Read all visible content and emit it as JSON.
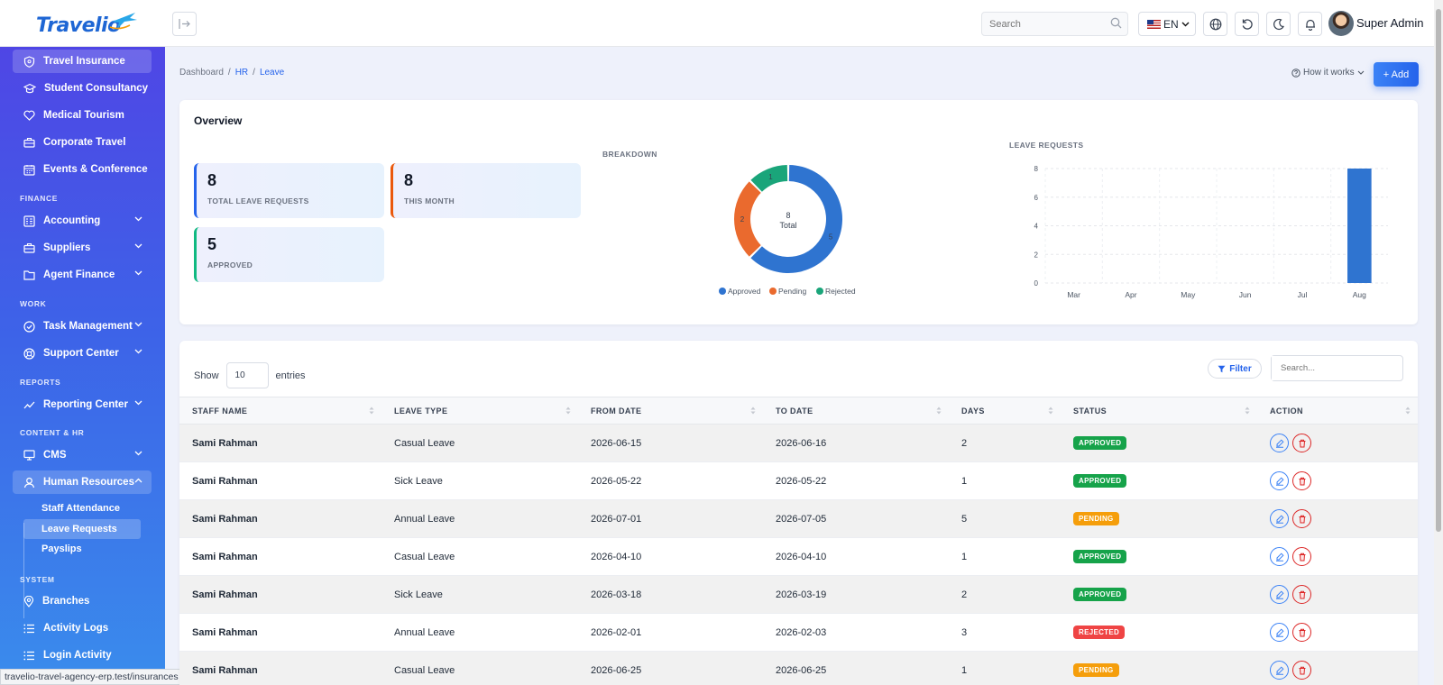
{
  "brand": {
    "name": "Travelio"
  },
  "header": {
    "search_placeholder": "Search",
    "language": "EN",
    "user_name": "Super Admin"
  },
  "sidebar": {
    "top_items": [
      {
        "label": "Travel Insurance",
        "icon": "shield-icon"
      },
      {
        "label": "Student Consultancy",
        "icon": "graduation-cap-icon"
      },
      {
        "label": "Medical Tourism",
        "icon": "heart-icon"
      },
      {
        "label": "Corporate Travel",
        "icon": "briefcase-icon"
      },
      {
        "label": "Events & Conference",
        "icon": "calendar-icon"
      }
    ],
    "sections": {
      "finance": "FINANCE",
      "work": "WORK",
      "reports": "REPORTS",
      "content_hr": "CONTENT & HR",
      "system": "SYSTEM"
    },
    "finance_items": [
      {
        "label": "Accounting"
      },
      {
        "label": "Suppliers"
      },
      {
        "label": "Agent Finance"
      }
    ],
    "work_items": [
      {
        "label": "Task Management"
      },
      {
        "label": "Support Center"
      }
    ],
    "reports_items": [
      {
        "label": "Reporting Center"
      }
    ],
    "content_items": [
      {
        "label": "CMS"
      },
      {
        "label": "Human Resources"
      }
    ],
    "hr_sub": [
      {
        "label": "Staff Attendance"
      },
      {
        "label": "Leave Requests"
      },
      {
        "label": "Payslips"
      }
    ],
    "system_items": [
      {
        "label": "Branches"
      },
      {
        "label": "Activity Logs"
      },
      {
        "label": "Login Activity"
      }
    ]
  },
  "status_url": "travelio-travel-agency-erp.test/insurances",
  "breadcrumb": [
    "Dashboard",
    "HR",
    "Leave"
  ],
  "actions": {
    "how_it_works": "How it works",
    "add": "+ Add"
  },
  "overview": {
    "title": "Overview",
    "stats": [
      {
        "value": "8",
        "label": "TOTAL LEAVE REQUESTS",
        "accent": "#2563eb"
      },
      {
        "value": "8",
        "label": "THIS MONTH",
        "accent": "#ea580c"
      },
      {
        "value": "5",
        "label": "APPROVED",
        "accent": "#10b981"
      }
    ],
    "breakdown_title": "BREAKDOWN",
    "leave_requests_title": "LEAVE REQUESTS"
  },
  "chart_data": [
    {
      "type": "pie",
      "variant": "donut",
      "title": "BREAKDOWN",
      "center_value": "8",
      "center_label": "Total",
      "categories": [
        "Approved",
        "Pending",
        "Rejected"
      ],
      "values": [
        5,
        2,
        1
      ],
      "colors": [
        "#2f74d0",
        "#ea6a2e",
        "#1aa57a"
      ],
      "legend": "bottom"
    },
    {
      "type": "bar",
      "title": "LEAVE REQUESTS",
      "categories": [
        "Mar",
        "Apr",
        "May",
        "Jun",
        "Jul",
        "Aug"
      ],
      "values": [
        0,
        0,
        0,
        0,
        0,
        8
      ],
      "ylim": [
        0,
        8
      ],
      "yticks": [
        "0",
        "2",
        "4",
        "6",
        "8"
      ],
      "grid": true,
      "color": "#2f74d0"
    }
  ],
  "table": {
    "show_label": "Show",
    "entries_value": "10",
    "entries_label": "entries",
    "filter_label": "Filter",
    "search_placeholder": "Search...",
    "headers": [
      "STAFF NAME",
      "LEAVE TYPE",
      "FROM DATE",
      "TO DATE",
      "DAYS",
      "STATUS",
      "ACTION"
    ],
    "rows": [
      {
        "name": "Sami Rahman",
        "type": "Casual Leave",
        "from": "2026-06-15",
        "to": "2026-06-16",
        "days": "2",
        "status": "APPROVED"
      },
      {
        "name": "Sami Rahman",
        "type": "Sick Leave",
        "from": "2026-05-22",
        "to": "2026-05-22",
        "days": "1",
        "status": "APPROVED"
      },
      {
        "name": "Sami Rahman",
        "type": "Annual Leave",
        "from": "2026-07-01",
        "to": "2026-07-05",
        "days": "5",
        "status": "PENDING"
      },
      {
        "name": "Sami Rahman",
        "type": "Casual Leave",
        "from": "2026-04-10",
        "to": "2026-04-10",
        "days": "1",
        "status": "APPROVED"
      },
      {
        "name": "Sami Rahman",
        "type": "Sick Leave",
        "from": "2026-03-18",
        "to": "2026-03-19",
        "days": "2",
        "status": "APPROVED"
      },
      {
        "name": "Sami Rahman",
        "type": "Annual Leave",
        "from": "2026-02-01",
        "to": "2026-02-03",
        "days": "3",
        "status": "REJECTED"
      },
      {
        "name": "Sami Rahman",
        "type": "Casual Leave",
        "from": "2026-06-25",
        "to": "2026-06-25",
        "days": "1",
        "status": "PENDING"
      }
    ],
    "status_colors": {
      "APPROVED": "#16a34a",
      "PENDING": "#f59e0b",
      "REJECTED": "#ef4444"
    }
  }
}
